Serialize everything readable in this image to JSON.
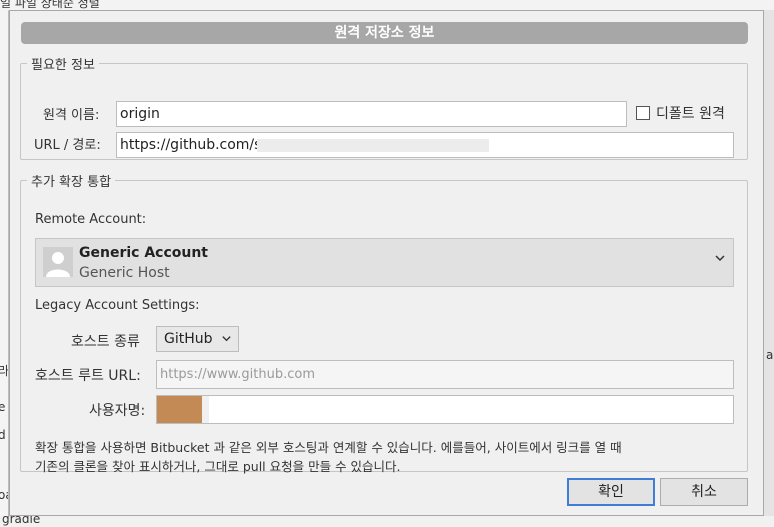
{
  "dialog": {
    "title": "원격 저장소 정보",
    "required_section": {
      "legend": "필요한 정보",
      "remote_name_label": "원격 이름:",
      "remote_name_value": "origin",
      "default_remote_label": "디폴트 원격",
      "url_label": "URL / 경로:",
      "url_value": "https://github.com/s"
    },
    "extended_section": {
      "legend": "추가 확장 통합",
      "remote_account_label": "Remote Account:",
      "account_name": "Generic Account",
      "account_host": "Generic Host",
      "legacy_label": "Legacy Account Settings:",
      "host_type_label": "호스트 종류",
      "host_type_value": "GitHub",
      "host_root_label": "호스트 루트 URL:",
      "host_root_placeholder": "https://www.github.com",
      "username_label": "사용자명:",
      "description_line1": "확장 통합을 사용하면 Bitbucket 과 같은 외부 호스팅과 연계할 수 있습니다. 에를들어, 사이트에서 링크를 열 때",
      "description_line2": "기존의 클론을 찾아 표시하거나, 그대로 pull 요청을 만들 수 있습니다."
    },
    "ok_label": "확인",
    "cancel_label": "취소"
  },
  "background": {
    "top_text": "일  파일 상태순 정렬",
    "left_texts": [
      "라",
      "e",
      "d",
      "oa"
    ],
    "right_text": "a",
    "bottom_text": "gradle"
  },
  "colors": {
    "title_bar": "#a7a7a7",
    "primary_border": "#3f7dd6",
    "avatar_swatch": "#c48a56"
  }
}
